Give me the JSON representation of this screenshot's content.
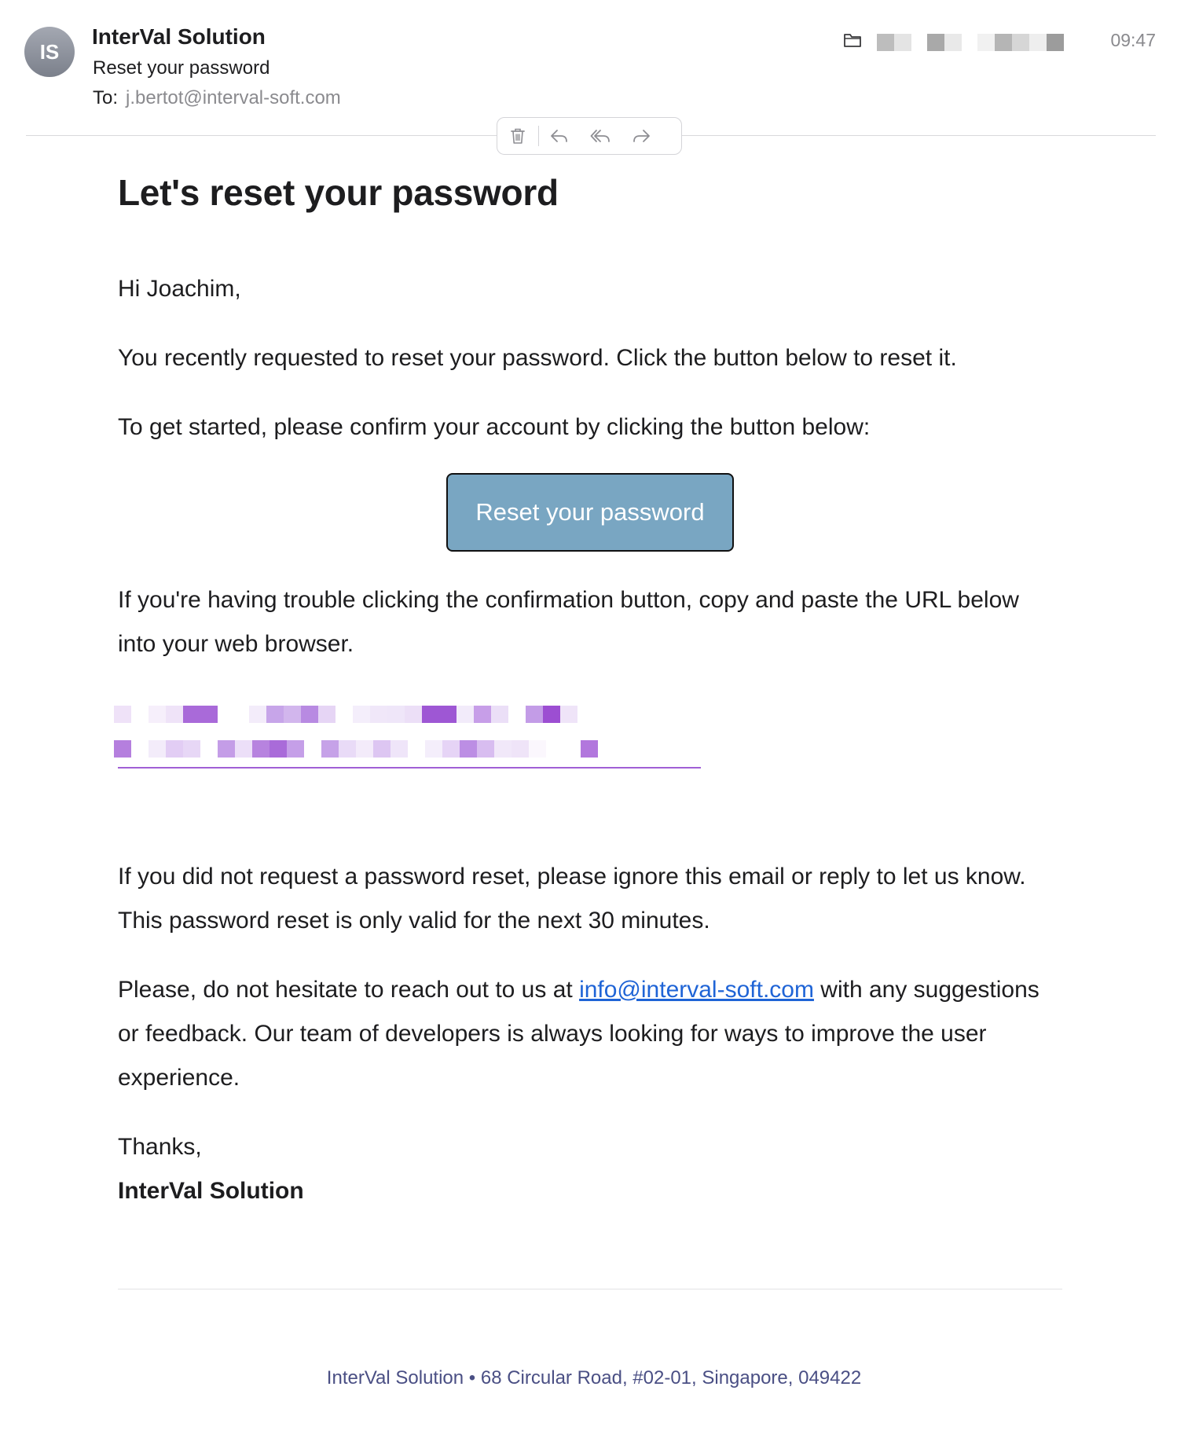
{
  "header": {
    "avatar_initials": "IS",
    "sender": "InterVal Solution",
    "subject": "Reset your password",
    "to_label": "To:",
    "to_address": "j.bertot@interval-soft.com",
    "time": "09:47"
  },
  "toolbar": {
    "actions": [
      "trash-icon",
      "reply-icon",
      "reply-all-icon",
      "forward-icon"
    ]
  },
  "email": {
    "title": "Let's reset your password",
    "greeting": "Hi Joachim,",
    "para1": "You recently requested to reset your password. Click the button below to reset it.",
    "para2": "To get started, please confirm your account by clicking the button below:",
    "button_label": "Reset your password",
    "para3": "If you're having trouble clicking the confirmation button, copy and paste the URL below into your web browser.",
    "para4": "If you did not request a password reset, please ignore this email or reply to let us know. This password reset is only valid for the next 30 minutes.",
    "para5_before": "Please, do not hesitate to reach out to us at ",
    "para5_link": "info@interval-soft.com",
    "para5_after": " with any suggestions or feedback. Our team of developers is always looking for ways to improve the user experience.",
    "thanks": "Thanks,",
    "signature": "InterVal Solution"
  },
  "footer": {
    "text": "InterVal Solution • 68 Circular Road, #02-01, Singapore, 049422"
  },
  "colors": {
    "button_bg": "#79a6c2",
    "link": "#1f64d6",
    "redacted_link": "#a05fd5",
    "footer_text": "#4a4f84"
  }
}
